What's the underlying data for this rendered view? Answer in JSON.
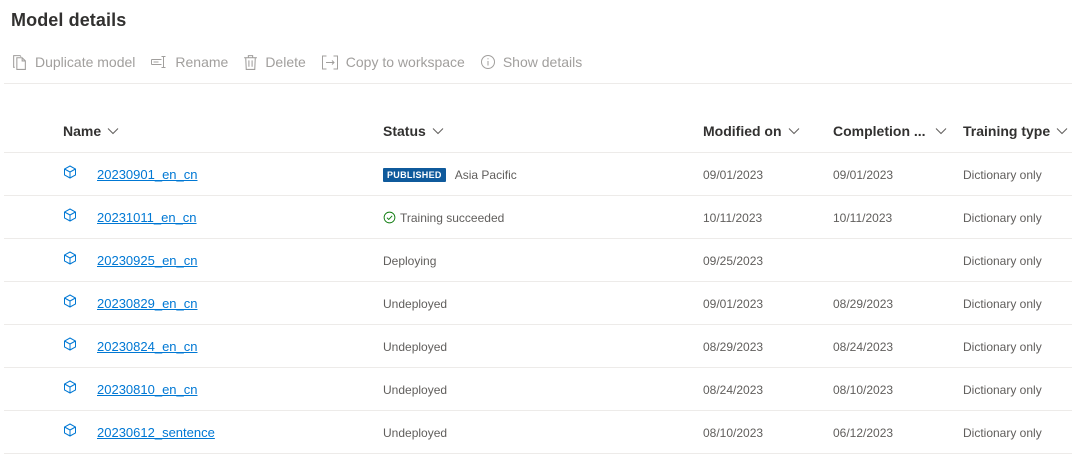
{
  "page": {
    "title": "Model details"
  },
  "toolbar": {
    "duplicate": "Duplicate model",
    "rename": "Rename",
    "delete": "Delete",
    "copy": "Copy to workspace",
    "details": "Show details"
  },
  "columns": {
    "name": "Name",
    "status": "Status",
    "modified": "Modified on",
    "completion": "Completion ...",
    "type": "Training type"
  },
  "rows": [
    {
      "name": "20230901_en_cn",
      "badge": "PUBLISHED",
      "status": "Asia Pacific",
      "modified": "09/01/2023",
      "completion": "09/01/2023",
      "type": "Dictionary only"
    },
    {
      "name": "20231011_en_cn",
      "status": "Training succeeded",
      "modified": "10/11/2023",
      "completion": "10/11/2023",
      "type": "Dictionary only"
    },
    {
      "name": "20230925_en_cn",
      "status": "Deploying",
      "modified": "09/25/2023",
      "completion": "",
      "type": "Dictionary only"
    },
    {
      "name": "20230829_en_cn",
      "status": "Undeployed",
      "modified": "09/01/2023",
      "completion": "08/29/2023",
      "type": "Dictionary only"
    },
    {
      "name": "20230824_en_cn",
      "status": "Undeployed",
      "modified": "08/29/2023",
      "completion": "08/24/2023",
      "type": "Dictionary only"
    },
    {
      "name": "20230810_en_cn",
      "status": "Undeployed",
      "modified": "08/24/2023",
      "completion": "08/10/2023",
      "type": "Dictionary only"
    },
    {
      "name": "20230612_sentence",
      "status": "Undeployed",
      "modified": "08/10/2023",
      "completion": "06/12/2023",
      "type": "Dictionary only"
    }
  ],
  "colors": {
    "link": "#0078d4",
    "badge": "#0f5a9c",
    "success": "#107c10",
    "disabled": "#a19f9d"
  }
}
